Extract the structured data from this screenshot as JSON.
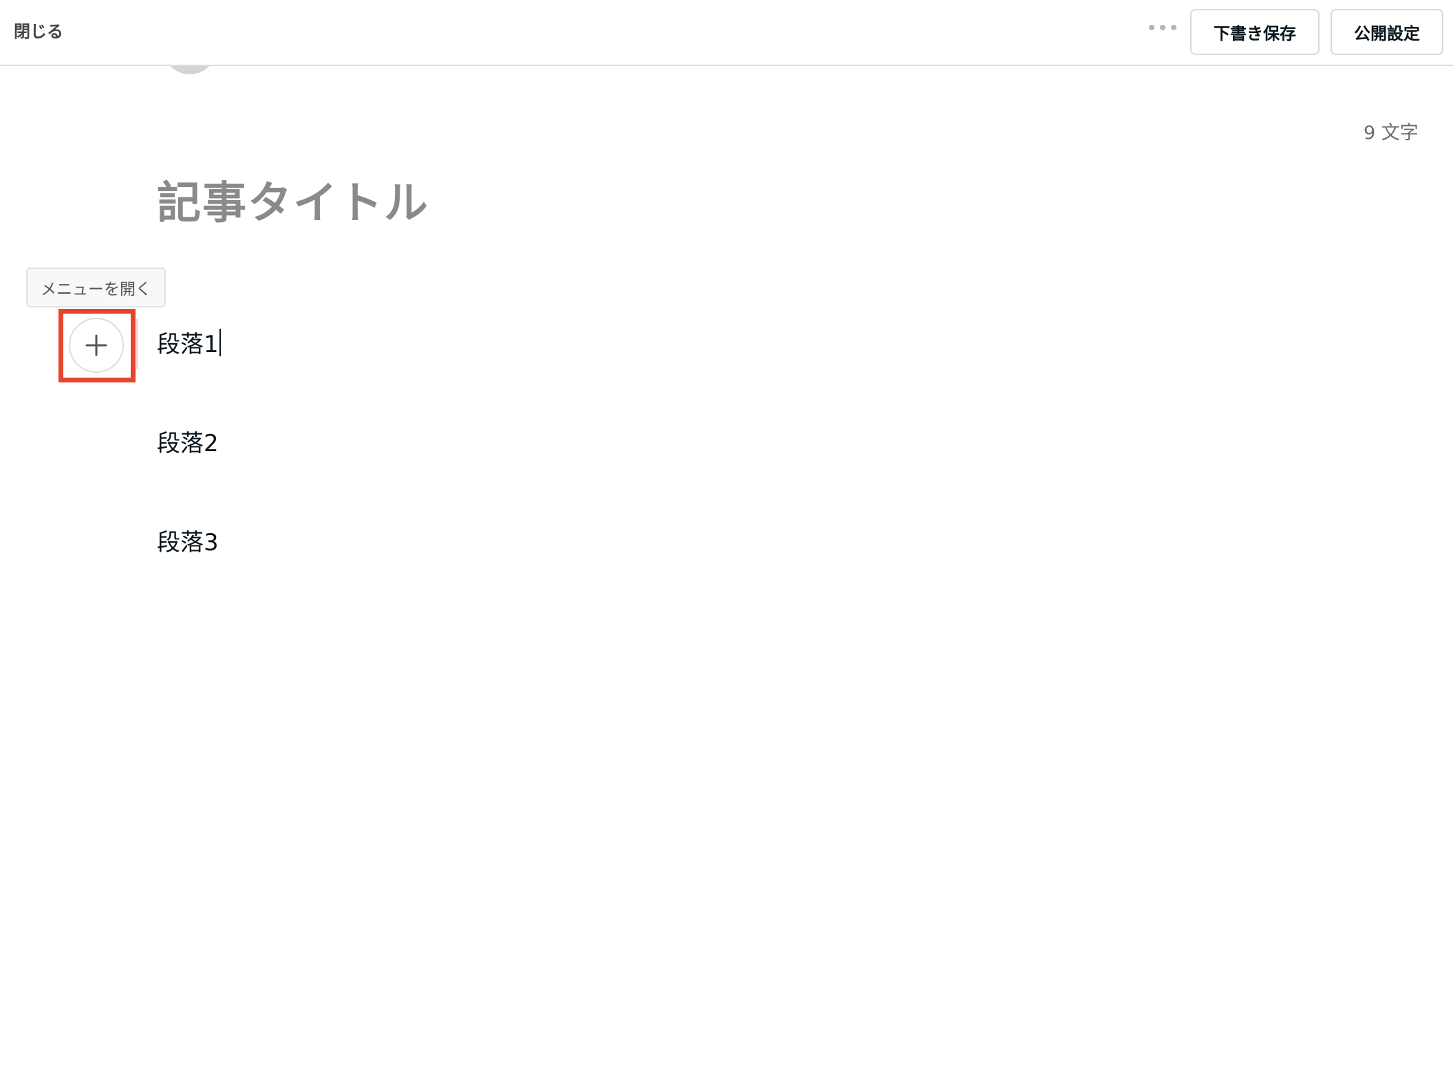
{
  "header": {
    "close_label": "閉じる",
    "more_icon": "more-horizontal-icon",
    "draft_save_label": "下書き保存",
    "publish_settings_label": "公開設定"
  },
  "editor": {
    "char_count": "9 文字",
    "title": "記事タイトル",
    "tooltip": "メニューを開く",
    "add_icon": "plus-icon",
    "highlight_color": "#e8442c",
    "paragraphs": [
      "段落1",
      "段落2",
      "段落3"
    ]
  }
}
